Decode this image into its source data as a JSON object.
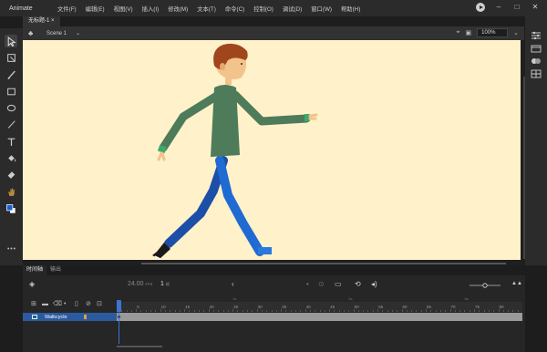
{
  "app": {
    "name": "Animate"
  },
  "menu": [
    "文件(F)",
    "编辑(E)",
    "视图(V)",
    "插入(I)",
    "修改(M)",
    "文本(T)",
    "命令(C)",
    "控制(O)",
    "调试(D)",
    "窗口(W)",
    "帮助(H)"
  ],
  "doc_tab": {
    "label": "无标题-1 ×"
  },
  "editbar": {
    "scene": "Scene 1",
    "zoom": "100%"
  },
  "timeline": {
    "tabs": [
      "时间轴",
      "输出"
    ],
    "fps": "24.00",
    "fps_unit": "FPS",
    "current_frame": "1",
    "frame_unit": "帧",
    "ruler": [
      "1",
      "5",
      "10",
      "15",
      "20",
      "25",
      "30",
      "35",
      "40",
      "45",
      "50",
      "55",
      "60",
      "65",
      "70",
      "75",
      "80"
    ],
    "seconds": [
      "1s",
      "2s",
      "3s"
    ],
    "layer": {
      "name": "Walkcycle"
    }
  },
  "colors": {
    "stage_bg": "#fff1c9",
    "accent": "#3d74cf",
    "shirt": "#4e7b5a",
    "pants": "#1b63c9",
    "hair": "#a0461d"
  }
}
